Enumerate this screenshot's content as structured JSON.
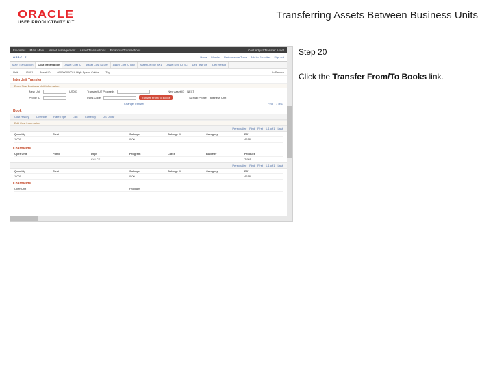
{
  "brand": {
    "name": "ORACLE",
    "subtitle": "USER PRODUCTIVITY KIT"
  },
  "page_title": "Transferring Assets Between Business Units",
  "step_label": "Step 20",
  "instruction": {
    "pre": "Click the ",
    "link": "Transfer From/To Books",
    "post": " link."
  },
  "shot": {
    "darkbar": {
      "items": [
        "Favorites",
        "Main Menu",
        "Asset Management",
        "Asset Transactions",
        "Financial Transactions",
        "Cost Adjust/Transfer Asset"
      ]
    },
    "oraclebar": {
      "logo": "ORACLE",
      "links": [
        "Home",
        "Worklist",
        "Performance Trace",
        "Add to Favorites",
        "Sign out"
      ]
    },
    "favorites": "Favorites",
    "tabs": [
      "Main Transaction",
      "Cost Information",
      "Asset Cost IU",
      "Asset Cost IU Det",
      "Asset Cost IU Bk2",
      "Asset Dep IU BK1",
      "Asset Dep IU BC",
      "Dep Test Vw",
      "Dep Result"
    ],
    "active_tab": 1,
    "subhead": {
      "unit_lbl": "Unit",
      "unit_val": "US001",
      "asset_lbl": "Asset ID",
      "asset_val": "000000000019   High Speed Cutter",
      "tag_lbl": "Tag",
      "status_lbl": "In Service"
    },
    "interunitTitle": "InterUnit Transfer",
    "newbuTitle": "Enter New Business Unit Information",
    "newbu": {
      "bu_lbl": "New Unit",
      "bu_val": "US003",
      "profile_lbl": "Profile ID",
      "profile_val": "",
      "trans_lbl": "Trans Code",
      "proceeds_lbl": "Transfer/IUT Proceeds",
      "transfer_btn": "Transfer From/To Books",
      "asset_lbl": "New Asset ID",
      "asset_val": "NEXT",
      "iuprof_lbl": "IU Map Profile",
      "iuval": "Business Unit"
    },
    "change_lbl": "Change Transfer",
    "bookTitle": "Book",
    "bookband": {
      "costHist": "Cost History",
      "ovr": "Override",
      "conv": "Rate Type",
      "dep": "LBE",
      "cur": "Currency",
      "curval": "US Dollar"
    },
    "costInfo": "Edit Cost Information",
    "grid": {
      "headers": [
        "Quantity",
        "Cost",
        "",
        "Salvage",
        "Salvage %",
        "Category",
        "Eff"
      ],
      "row": [
        "1.000",
        "",
        "",
        "0.00",
        "",
        "",
        "4618"
      ]
    },
    "chartTitle": "Chartfields",
    "chart": {
      "headers": [
        "Oper Unit",
        "Fund",
        "Dept",
        "Program",
        "Class",
        "Bud Ref",
        "Product"
      ],
      "row": [
        "",
        "",
        "CALCE",
        "",
        "",
        "",
        "7.955"
      ]
    },
    "grid2": {
      "headers": [
        "Quantity",
        "Cost",
        "",
        "Salvage",
        "Salvage %",
        "Category",
        "Eff"
      ],
      "row": [
        "1.000",
        "",
        "",
        "0.00",
        "",
        "",
        "4618"
      ]
    },
    "chart2Title": "Chartfields",
    "chart2row": [
      "Oper Unit",
      "",
      "",
      "Program",
      "",
      "",
      ""
    ],
    "pager": {
      "personalize": "Personalize",
      "find": "Find",
      "first": "First",
      "range": "1 of 1",
      "last": "Last",
      "range2": "1-1 of 1"
    }
  }
}
